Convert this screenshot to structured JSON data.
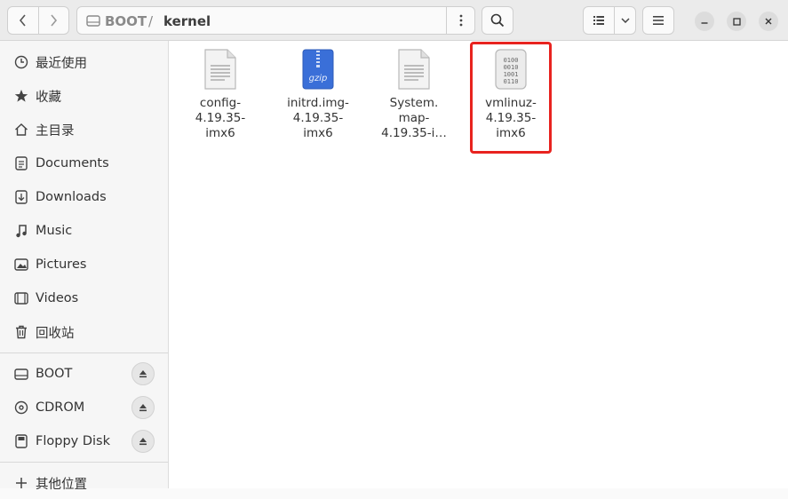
{
  "path": {
    "drive": "BOOT",
    "separator": "/",
    "current": "kernel"
  },
  "sidebar": {
    "places": [
      {
        "label": "最近使用",
        "icon": "clock-icon"
      },
      {
        "label": "收藏",
        "icon": "star-icon"
      },
      {
        "label": "主目录",
        "icon": "home-icon"
      },
      {
        "label": "Documents",
        "icon": "document-icon"
      },
      {
        "label": "Downloads",
        "icon": "download-icon"
      },
      {
        "label": "Music",
        "icon": "music-icon"
      },
      {
        "label": "Pictures",
        "icon": "picture-icon"
      },
      {
        "label": "Videos",
        "icon": "video-icon"
      },
      {
        "label": "回收站",
        "icon": "trash-icon"
      }
    ],
    "devices": [
      {
        "label": "BOOT",
        "icon": "drive-icon"
      },
      {
        "label": "CDROM",
        "icon": "disc-icon"
      },
      {
        "label": "Floppy Disk",
        "icon": "floppy-icon"
      }
    ],
    "other": {
      "label": "其他位置",
      "icon": "plus-icon"
    }
  },
  "files": [
    {
      "name_lines": [
        "config-",
        "4.19.35-",
        "imx6"
      ],
      "type": "text"
    },
    {
      "name_lines": [
        "initrd.img-",
        "4.19.35-",
        "imx6"
      ],
      "type": "gzip"
    },
    {
      "name_lines": [
        "System.",
        "map-",
        "4.19.35-i…"
      ],
      "type": "text"
    },
    {
      "name_lines": [
        "vmlinuz-",
        "4.19.35-",
        "imx6"
      ],
      "type": "binary",
      "selected": true
    }
  ],
  "icon_text": {
    "gzip": "gzip",
    "binary_rows": [
      "0100",
      "0010",
      "1001",
      "0110"
    ]
  },
  "colors": {
    "highlight": "#e8231f",
    "gzip_blue": "#3a6fd8"
  }
}
